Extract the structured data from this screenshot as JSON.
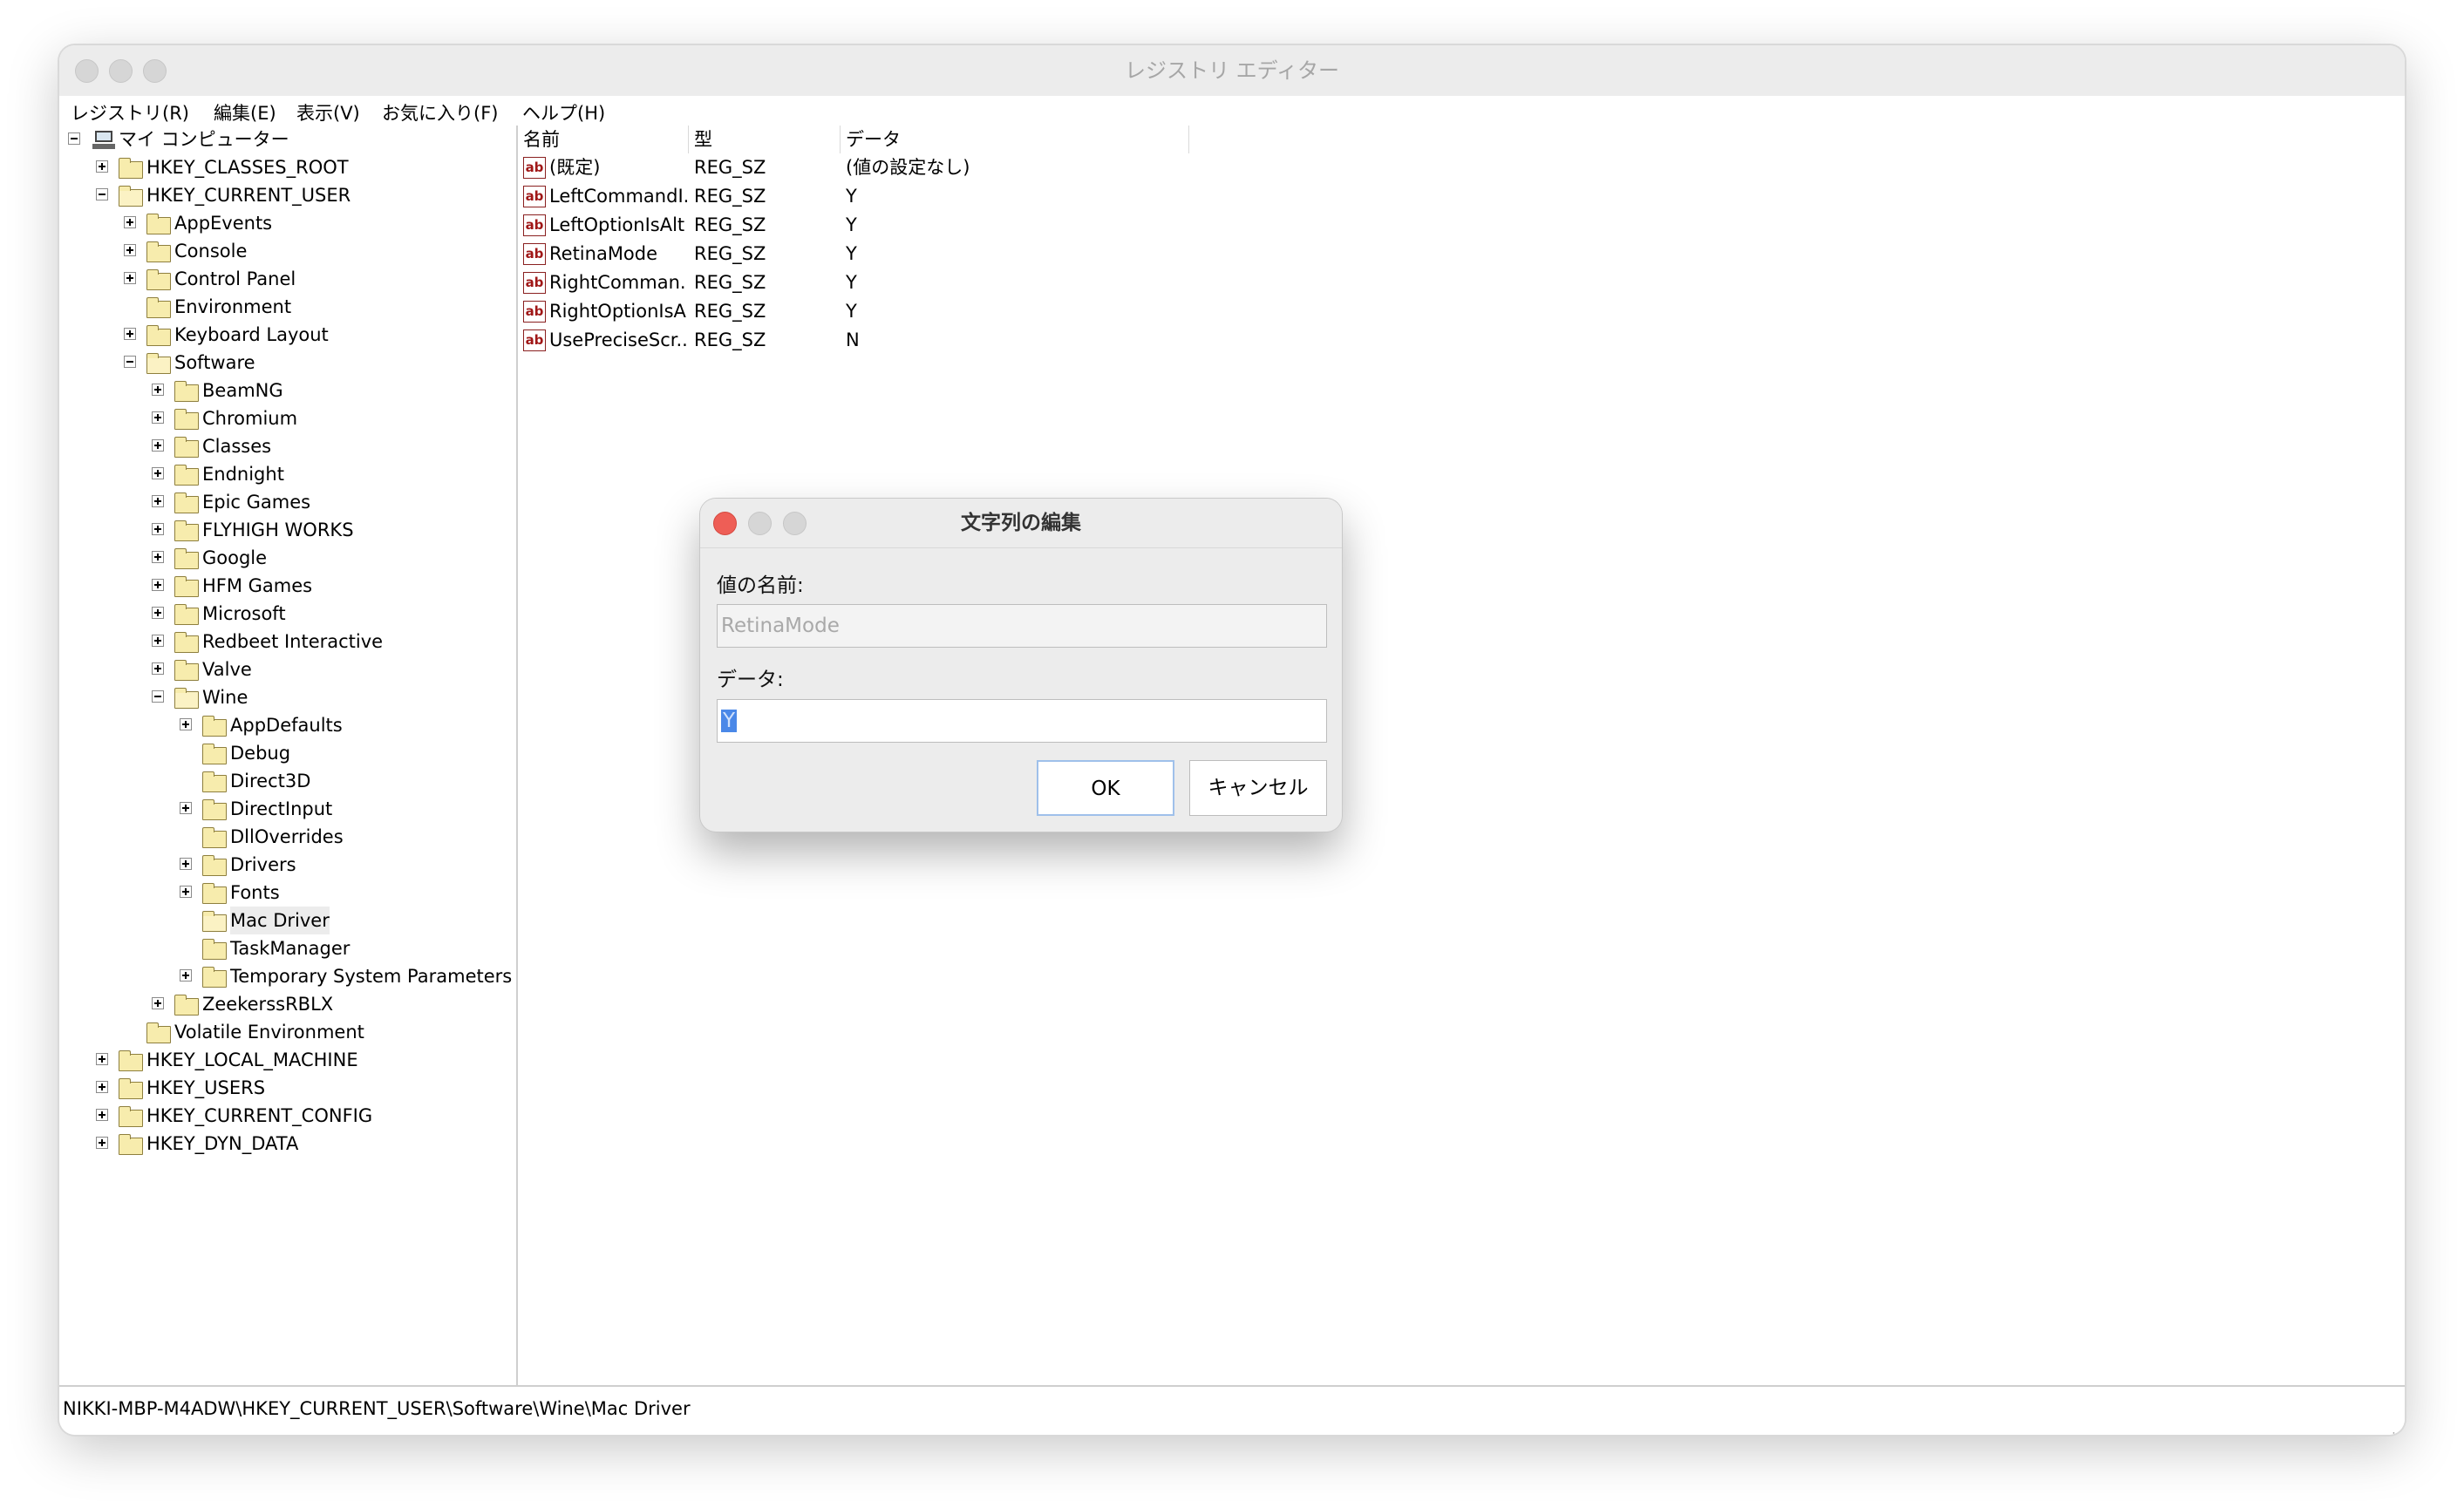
{
  "window": {
    "title": "レジストリ エディター"
  },
  "menu": [
    "レジストリ(R)",
    "編集(E)",
    "表示(V)",
    "お気に入り(F)",
    "ヘルプ(H)"
  ],
  "tree": {
    "root": "マイ コンピューター",
    "hkcr": "HKEY_CLASSES_ROOT",
    "hkcu": "HKEY_CURRENT_USER",
    "appevents": "AppEvents",
    "console": "Console",
    "control_panel": "Control Panel",
    "environment": "Environment",
    "keyboard_layout": "Keyboard Layout",
    "software": "Software",
    "beamng": "BeamNG",
    "chromium": "Chromium",
    "classes": "Classes",
    "endnight": "Endnight",
    "epic_games": "Epic Games",
    "flyhigh": "FLYHIGH WORKS",
    "google": "Google",
    "hfm": "HFM Games",
    "microsoft": "Microsoft",
    "redbeet": "Redbeet Interactive",
    "valve": "Valve",
    "wine": "Wine",
    "appdefaults": "AppDefaults",
    "debug": "Debug",
    "direct3d": "Direct3D",
    "directinput": "DirectInput",
    "dlloverrides": "DllOverrides",
    "drivers": "Drivers",
    "fonts": "Fonts",
    "mac_driver": "Mac Driver",
    "taskmanager": "TaskManager",
    "temp_params": "Temporary System Parameters",
    "zeekers": "ZeekerssRBLX",
    "volatile_env": "Volatile Environment",
    "hklm": "HKEY_LOCAL_MACHINE",
    "hku": "HKEY_USERS",
    "hkcc": "HKEY_CURRENT_CONFIG",
    "hkdd": "HKEY_DYN_DATA"
  },
  "list": {
    "columns": {
      "name": "名前",
      "type": "型",
      "data": "データ"
    },
    "rows": [
      {
        "icon": "ab",
        "name": "(既定)",
        "type": "REG_SZ",
        "data": "(値の設定なし)"
      },
      {
        "icon": "ab",
        "name": "LeftCommandI...",
        "type": "REG_SZ",
        "data": "Y"
      },
      {
        "icon": "ab",
        "name": "LeftOptionIsAlt",
        "type": "REG_SZ",
        "data": "Y"
      },
      {
        "icon": "ab",
        "name": "RetinaMode",
        "type": "REG_SZ",
        "data": "Y"
      },
      {
        "icon": "ab",
        "name": "RightComman...",
        "type": "REG_SZ",
        "data": "Y"
      },
      {
        "icon": "ab",
        "name": "RightOptionIsAlt",
        "type": "REG_SZ",
        "data": "Y"
      },
      {
        "icon": "ab",
        "name": "UsePreciseScr...",
        "type": "REG_SZ",
        "data": "N"
      }
    ]
  },
  "status": {
    "path": "NIKKI-MBP-M4ADW\\HKEY_CURRENT_USER\\Software\\Wine\\Mac Driver"
  },
  "dialog": {
    "title": "文字列の編集",
    "name_label": "値の名前:",
    "name_value": "RetinaMode",
    "data_label": "データ:",
    "data_value": "Y",
    "ok": "OK",
    "cancel": "キャンセル"
  },
  "colors": {
    "close_red": "#ee5e56",
    "selection_blue": "#4a88e8",
    "folder_yellow": "#f7ecad"
  }
}
